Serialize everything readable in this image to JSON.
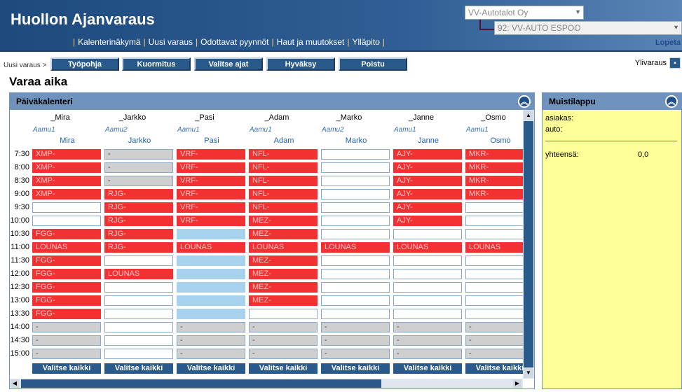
{
  "header": {
    "title": "Huollon Ajanvaraus",
    "nav": [
      "Kalenterinäkymä",
      "Uusi varaus",
      "Odottavat pyynnöt",
      "Haut ja muutokset",
      "Ylläpito"
    ],
    "company_select": "VV-Autotalot Oy",
    "site_select": "92: VV-AUTO ESPOO",
    "logout": "Lopeta"
  },
  "toolbar": {
    "breadcrumb": "Uusi varaus >",
    "buttons": [
      "Työpohja",
      "Kuormitus",
      "Valitse ajat",
      "Hyväksy",
      "Poistu"
    ],
    "overbooking_label": "Ylivaraus"
  },
  "page_title": "Varaa aika",
  "calendar": {
    "title": "Päiväkalenteri",
    "employees": [
      {
        "code": "_Mira",
        "shift": "Aamu1",
        "name": "Mira"
      },
      {
        "code": "_Jarkko",
        "shift": "Aamu2",
        "name": "Jarkko"
      },
      {
        "code": "_Pasi",
        "shift": "Aamu1",
        "name": "Pasi"
      },
      {
        "code": "_Adam",
        "shift": "Aamu1",
        "name": "Adam"
      },
      {
        "code": "_Marko",
        "shift": "Aamu2",
        "name": "Marko"
      },
      {
        "code": "_Janne",
        "shift": "Aamu1",
        "name": "Janne"
      },
      {
        "code": "_Osmo",
        "shift": "Aamu1",
        "name": "Osmo"
      }
    ],
    "times": [
      "7:30",
      "8:00",
      "8:30",
      "9:00",
      "9:30",
      "10:00",
      "10:30",
      "11:00",
      "11:30",
      "12:00",
      "12:30",
      "13:00",
      "13:30",
      "14:00",
      "14:30",
      "15:00"
    ],
    "columns": [
      [
        [
          "r",
          "XMP-"
        ],
        [
          "r",
          "XMP-"
        ],
        [
          "r",
          "XMP-"
        ],
        [
          "r",
          "XMP-"
        ],
        [
          "w",
          ""
        ],
        [
          "w",
          ""
        ],
        [
          "r",
          "FGG-"
        ],
        [
          "r",
          "LOUNAS"
        ],
        [
          "r",
          "FGG-"
        ],
        [
          "r",
          "FGG-"
        ],
        [
          "r",
          "FGG-"
        ],
        [
          "r",
          "FGG-"
        ],
        [
          "r",
          "FGG-"
        ],
        [
          "g",
          "-"
        ],
        [
          "g",
          "-"
        ],
        [
          "g",
          "-"
        ]
      ],
      [
        [
          "g",
          "-"
        ],
        [
          "g",
          "-"
        ],
        [
          "g",
          "-"
        ],
        [
          "r",
          "RJG-"
        ],
        [
          "r",
          "RJG-"
        ],
        [
          "r",
          "RJG-"
        ],
        [
          "r",
          "RJG-"
        ],
        [
          "r",
          "RJG-"
        ],
        [
          "w",
          ""
        ],
        [
          "r",
          "LOUNAS"
        ],
        [
          "w",
          ""
        ],
        [
          "w",
          ""
        ],
        [
          "w",
          ""
        ],
        [
          "w",
          ""
        ],
        [
          "w",
          ""
        ],
        [
          "w",
          ""
        ]
      ],
      [
        [
          "r",
          "VRF-"
        ],
        [
          "r",
          "VRF-"
        ],
        [
          "r",
          "VRF-"
        ],
        [
          "r",
          "VRF-"
        ],
        [
          "r",
          "VRF-"
        ],
        [
          "r",
          "VRF-"
        ],
        [
          "b",
          ""
        ],
        [
          "r",
          "LOUNAS"
        ],
        [
          "b",
          ""
        ],
        [
          "b",
          ""
        ],
        [
          "b",
          ""
        ],
        [
          "b",
          ""
        ],
        [
          "b",
          ""
        ],
        [
          "g",
          "-"
        ],
        [
          "g",
          "-"
        ],
        [
          "g",
          "-"
        ]
      ],
      [
        [
          "r",
          "NFL-"
        ],
        [
          "r",
          "NFL-"
        ],
        [
          "r",
          "NFL-"
        ],
        [
          "r",
          "NFL-"
        ],
        [
          "r",
          "NFL-"
        ],
        [
          "r",
          "MEZ-"
        ],
        [
          "r",
          "MEZ-"
        ],
        [
          "r",
          "LOUNAS"
        ],
        [
          "r",
          "MEZ-"
        ],
        [
          "r",
          "MEZ-"
        ],
        [
          "r",
          "MEZ-"
        ],
        [
          "r",
          "MEZ-"
        ],
        [
          "w",
          ""
        ],
        [
          "g",
          "-"
        ],
        [
          "g",
          "-"
        ],
        [
          "g",
          "-"
        ]
      ],
      [
        [
          "w",
          ""
        ],
        [
          "w",
          ""
        ],
        [
          "w",
          ""
        ],
        [
          "w",
          ""
        ],
        [
          "w",
          ""
        ],
        [
          "w",
          ""
        ],
        [
          "w",
          ""
        ],
        [
          "r",
          "LOUNAS"
        ],
        [
          "w",
          ""
        ],
        [
          "w",
          ""
        ],
        [
          "w",
          ""
        ],
        [
          "w",
          ""
        ],
        [
          "w",
          ""
        ],
        [
          "g",
          "-"
        ],
        [
          "g",
          "-"
        ],
        [
          "g",
          "-"
        ]
      ],
      [
        [
          "r",
          "AJY-"
        ],
        [
          "r",
          "AJY-"
        ],
        [
          "r",
          "AJY-"
        ],
        [
          "r",
          "AJY-"
        ],
        [
          "r",
          "AJY-"
        ],
        [
          "r",
          "AJY-"
        ],
        [
          "w",
          ""
        ],
        [
          "r",
          "LOUNAS"
        ],
        [
          "w",
          ""
        ],
        [
          "w",
          ""
        ],
        [
          "w",
          ""
        ],
        [
          "w",
          ""
        ],
        [
          "w",
          ""
        ],
        [
          "g",
          "-"
        ],
        [
          "g",
          "-"
        ],
        [
          "g",
          "-"
        ]
      ],
      [
        [
          "r",
          "MKR-"
        ],
        [
          "r",
          "MKR-"
        ],
        [
          "r",
          "MKR-"
        ],
        [
          "r",
          "MKR-"
        ],
        [
          "w",
          ""
        ],
        [
          "w",
          ""
        ],
        [
          "w",
          ""
        ],
        [
          "r",
          "LOUNAS"
        ],
        [
          "w",
          ""
        ],
        [
          "w",
          ""
        ],
        [
          "w",
          ""
        ],
        [
          "w",
          ""
        ],
        [
          "w",
          ""
        ],
        [
          "g",
          "-"
        ],
        [
          "g",
          "-"
        ],
        [
          "g",
          "-"
        ]
      ]
    ],
    "select_all_label": "Valitse kaikki"
  },
  "memo": {
    "title": "Muistilappu",
    "customer_label": "asiakas:",
    "car_label": "auto:",
    "total_label": "yhteensä:",
    "total_value": "0,0"
  }
}
